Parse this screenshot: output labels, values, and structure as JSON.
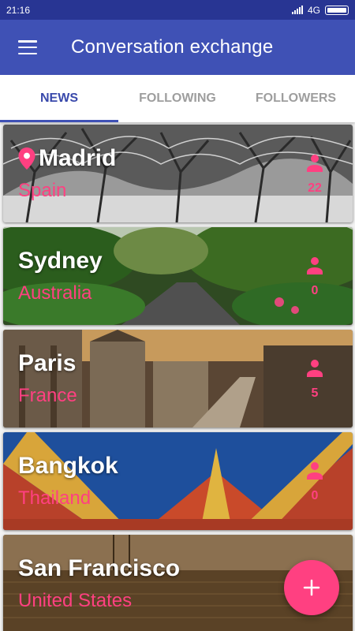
{
  "status_bar": {
    "time": "21:16",
    "network": "4G"
  },
  "app_bar": {
    "title": "Conversation exchange",
    "menu_icon": "hamburger-menu-icon"
  },
  "tabs": [
    {
      "label": "NEWS",
      "active": true
    },
    {
      "label": "FOLLOWING",
      "active": false
    },
    {
      "label": "FOLLOWERS",
      "active": false
    }
  ],
  "colors": {
    "primary": "#3f51b5",
    "primary_dark": "#283593",
    "accent": "#ff4081"
  },
  "cards": [
    {
      "city": "Madrid",
      "country": "Spain",
      "count": "22",
      "has_pin": true
    },
    {
      "city": "Sydney",
      "country": "Australia",
      "count": "0",
      "has_pin": false
    },
    {
      "city": "Paris",
      "country": "France",
      "count": "5",
      "has_pin": false
    },
    {
      "city": "Bangkok",
      "country": "Thailand",
      "count": "0",
      "has_pin": false
    },
    {
      "city": "San Francisco",
      "country": "United States",
      "count": "",
      "has_pin": false
    }
  ],
  "fab": {
    "icon": "plus-icon"
  }
}
